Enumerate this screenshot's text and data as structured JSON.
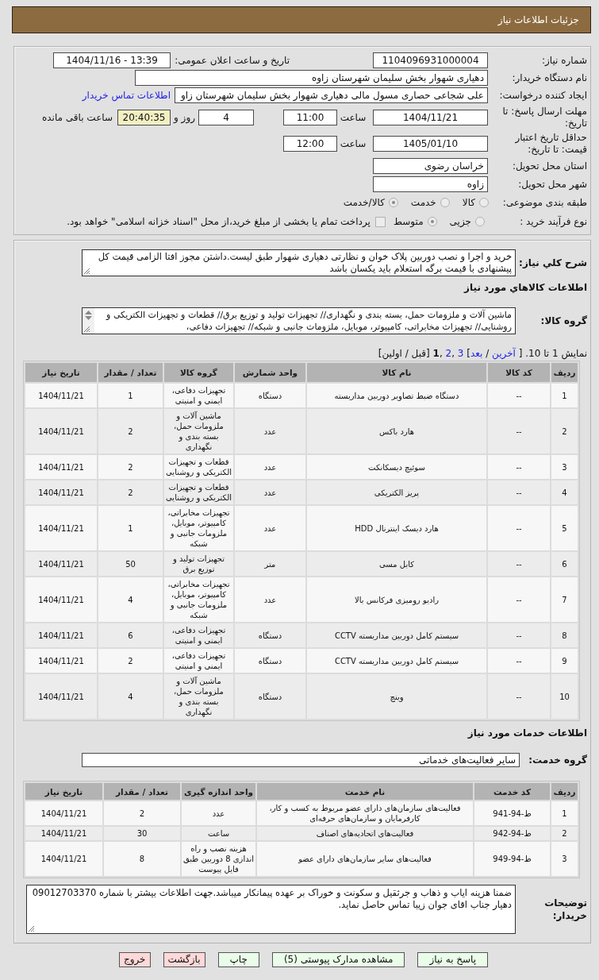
{
  "header": {
    "title": "جزئیات اطلاعات نیاز"
  },
  "details": {
    "need_number": {
      "label": "شماره نیاز:",
      "value": "1104096931000004"
    },
    "announce": {
      "label": "تاریخ و ساعت اعلان عمومی:",
      "value": "1404/11/16 - 13:39"
    },
    "buyer": {
      "label": "نام دستگاه خریدار:",
      "value": "دهیاری شهوار بخش سلیمان شهرستان زاوه"
    },
    "requester": {
      "label": "ایجاد کننده درخواست:",
      "value": "علی شجاعی حصاری مسول مالی دهیاری شهوار بخش سلیمان شهرستان زاو",
      "link": "اطلاعات تماس خریدار"
    },
    "deadline": {
      "label": "مهلت ارسال پاسخ: تا تاریخ:",
      "date": "1404/11/21",
      "time_label": "ساعت",
      "time": "11:00",
      "days": "4",
      "days_label": "روز و",
      "remaining": "20:40:35",
      "remaining_label": "ساعت باقی مانده"
    },
    "validity": {
      "label": "حداقل تاریخ اعتبار قیمت: تا تاریخ:",
      "date": "1405/01/10",
      "time_label": "ساعت",
      "time": "12:00"
    },
    "province": {
      "label": "استان محل تحویل:",
      "value": "خراسان رضوی"
    },
    "city": {
      "label": "شهر محل تحویل:",
      "value": "زاوه"
    },
    "category": {
      "label": "طبقه بندی موضوعی:",
      "disabled": true,
      "options": [
        {
          "label": "کالا",
          "selected": false
        },
        {
          "label": "خدمت",
          "selected": false
        },
        {
          "label": "کالا/خدمت",
          "selected": true
        }
      ]
    },
    "process": {
      "label": "نوع فرآیند خرید :",
      "disabled": true,
      "options": [
        {
          "label": "جزیی",
          "selected": false
        },
        {
          "label": "متوسط",
          "selected": true
        }
      ],
      "treasury": {
        "checked": false,
        "label": "پرداخت تمام یا بخشی از مبلغ خرید،از محل \"اسناد خزانه اسلامی\" خواهد بود."
      }
    }
  },
  "description": {
    "label": "شرح کلي نیاز:",
    "value": "خرید و اجرا و نصب دوربین پلاک خوان و نظارتی دهیاری شهوار طبق لیست.داشتن مجوز افتا الزامی قیمت کل پیشنهادی با قیمت برگه استعلام باید یکسان باشد"
  },
  "goods": {
    "heading": "اطلاعات کالاهاي مورد نیاز",
    "group_label": "گروه کالا:",
    "group_value": "ماشین آلات و ملزومات حمل، بسته بندی و نگهداری// تجهیزات تولید و توزیع برق// قطعات و تجهیزات الکتریکی و روشنایی// تجهیزات مخابراتی، کامپیوتر، موبایل، ملزومات جانبی و شبکه// تجهیزات دفاعی،",
    "pagination": [
      {
        "text": "نمایش 1 تا 10. [ ",
        "kind": "text"
      },
      {
        "text": "آخرین",
        "kind": "link"
      },
      {
        "text": " / ",
        "kind": "text"
      },
      {
        "text": "بعد",
        "kind": "link"
      },
      {
        "text": "] ",
        "kind": "text"
      },
      {
        "text": "3",
        "kind": "link"
      },
      {
        "text": " ,",
        "kind": "text"
      },
      {
        "text": "2",
        "kind": "link"
      },
      {
        "text": " ,",
        "kind": "text"
      },
      {
        "text": "1",
        "kind": "current"
      },
      {
        "text": " [قبل / اولین]",
        "kind": "text"
      }
    ],
    "table": {
      "columns": [
        "ردیف",
        "کد کالا",
        "نام کالا",
        "واحد شمارش",
        "گروه کالا",
        "تعداد / مقدار",
        "تاریخ نیاز"
      ],
      "rows": [
        [
          "1",
          "--",
          "دستگاه ضبط تصاویر دوربین مداربسته",
          "دستگاه",
          "تجهیزات دفاعی، ایمنی و امنیتی",
          "1",
          "1404/11/21"
        ],
        [
          "2",
          "--",
          "هارد باکس",
          "عدد",
          "ماشین آلات و ملزومات حمل، بسته بندی و نگهداری",
          "2",
          "1404/11/21"
        ],
        [
          "3",
          "--",
          "سوئیچ دیسکانکت",
          "عدد",
          "قطعات و تجهیزات الکتریکی و روشنایی",
          "2",
          "1404/11/21"
        ],
        [
          "4",
          "--",
          "پریز الکتریکی",
          "عدد",
          "قطعات و تجهیزات الکتریکی و روشنایی",
          "2",
          "1404/11/21"
        ],
        [
          "5",
          "--",
          "هارد دیسک اینترنال HDD",
          "عدد",
          "تجهیزات مخابراتی، کامپیوتر، موبایل، ملزومات جانبی و شبکه",
          "1",
          "1404/11/21"
        ],
        [
          "6",
          "--",
          "کابل مسی",
          "متر",
          "تجهیزات تولید و توزیع برق",
          "50",
          "1404/11/21"
        ],
        [
          "7",
          "--",
          "رادیو رومیزی فرکانس بالا",
          "عدد",
          "تجهیزات مخابراتی، کامپیوتر، موبایل، ملزومات جانبی و شبکه",
          "4",
          "1404/11/21"
        ],
        [
          "8",
          "--",
          "سیستم کامل دوربین مداربسته CCTV",
          "دستگاه",
          "تجهیزات دفاعی، ایمنی و امنیتی",
          "6",
          "1404/11/21"
        ],
        [
          "9",
          "--",
          "سیستم کامل دوربین مداربسته CCTV",
          "دستگاه",
          "تجهیزات دفاعی، ایمنی و امنیتی",
          "2",
          "1404/11/21"
        ],
        [
          "10",
          "--",
          "وینچ",
          "دستگاه",
          "ماشین آلات و ملزومات حمل، بسته بندی و نگهداری",
          "4",
          "1404/11/21"
        ]
      ]
    }
  },
  "services": {
    "heading": "اطلاعات خدمات مورد نیاز",
    "group_label": "گروه خدمت:",
    "group_value": "سایر فعالیت‌های خدماتی",
    "table": {
      "columns": [
        "ردیف",
        "کد خدمت",
        "نام خدمت",
        "واحد اندازه گیری",
        "تعداد / مقدار",
        "تاریخ نیاز"
      ],
      "rows": [
        [
          "1",
          "ط-94-941",
          "فعالیت‌های سازمان‌های دارای عضو مربوط به کسب و کار، کارفرمایان و سازمان‌های حرفه‌ای",
          "عدد",
          "2",
          "1404/11/21"
        ],
        [
          "2",
          "ط-94-942",
          "فعالیت‌های اتحادیه‌های اصناف",
          "ساعت",
          "30",
          "1404/11/21"
        ],
        [
          "3",
          "ط-94-949",
          "فعالیت‌های سایر سازمان‌های دارای عضو",
          "هزینه نصب و راه اندازی 8 دوربین طبق فایل پیوست",
          "8",
          "1404/11/21"
        ]
      ]
    }
  },
  "notes": {
    "label": "توضیحات خریدار:",
    "value": "ضمنا هزینه ایاب و ذهاب و جرثقیل و سکونت و خوراک بر عهده پیمانکار میباشد.جهت اطلاعات بیشتر با شماره 09012703370 دهیار جناب اقای جوان زیبا تماس حاصل نماید."
  },
  "buttons": [
    {
      "label": "پاسخ به نیاز",
      "kind": "positive"
    },
    {
      "label": "مشاهده مدارک پیوستی (5)",
      "kind": "positive"
    },
    {
      "label": "چاپ",
      "kind": "positive"
    },
    {
      "label": "بازگشت",
      "kind": "negative"
    },
    {
      "label": "خروج",
      "kind": "negative"
    }
  ]
}
